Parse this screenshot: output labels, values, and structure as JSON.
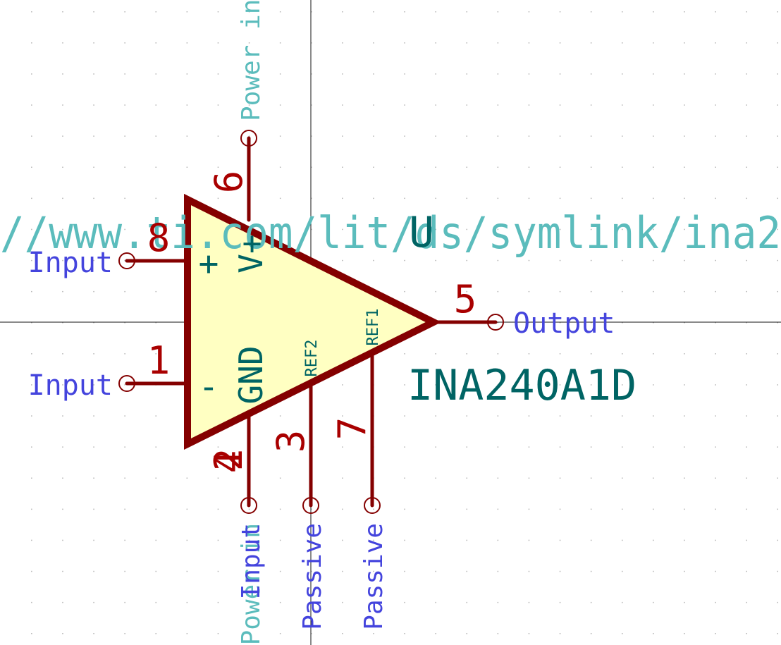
{
  "symbol": {
    "reference": "U",
    "value": "INA240A1D",
    "datasheet_fragment": "//www.ti.com/lit/ds/symlink/ina2"
  },
  "pins": [
    {
      "id": "pin-8",
      "number": "8",
      "name": "+",
      "electrical_type": "Input"
    },
    {
      "id": "pin-1",
      "number": "1",
      "name": "-",
      "electrical_type": "Input"
    },
    {
      "id": "pin-6",
      "number": "6",
      "name": "V+",
      "electrical_type": "Power in"
    },
    {
      "id": "pin-5",
      "number": "5",
      "name": "",
      "electrical_type": "Output"
    },
    {
      "id": "pin-2",
      "number": "2",
      "name": "",
      "electrical_type": "Input"
    },
    {
      "id": "pin-4",
      "number": "4",
      "name": "GND",
      "electrical_type": "Power in"
    },
    {
      "id": "pin-3",
      "number": "3",
      "name": "REF2",
      "electrical_type": "Passive"
    },
    {
      "id": "pin-7",
      "number": "7",
      "name": "REF1",
      "electrical_type": "Passive"
    }
  ],
  "colors": {
    "background": "#ffffff",
    "grid_dot": "#b4b4b4",
    "crosshair": "#141414",
    "body_outline": "#840000",
    "body_fill": "#ffffc2",
    "pin_line": "#840000",
    "pin_number": "#a90000",
    "pin_name": "#006464",
    "pin_type": "#4444dd",
    "field_text": "#006464",
    "hidden_field_text": "#5bbcbc"
  }
}
